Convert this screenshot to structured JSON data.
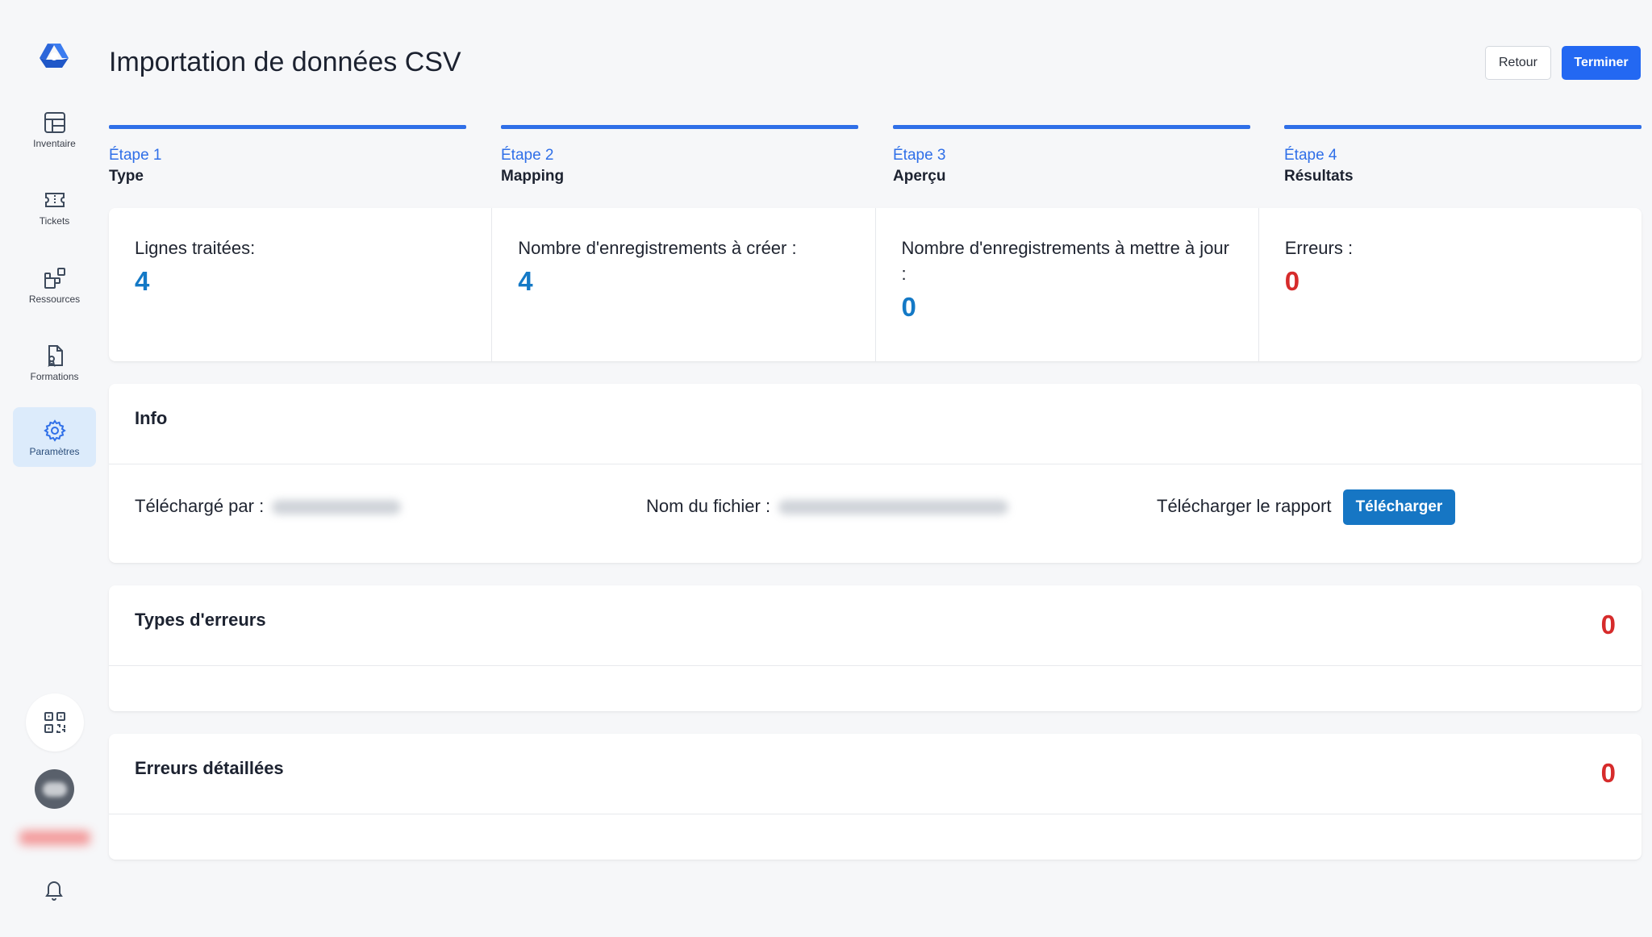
{
  "colors": {
    "accent": "#2f6fe8",
    "primary_button": "#2368f2",
    "download_button": "#1676c4",
    "count_blue": "#1479c6",
    "count_red": "#d62b2b",
    "sidebar_active_bg": "#dcebfb"
  },
  "sidebar": {
    "items": [
      {
        "label": "Inventaire",
        "icon": "table-icon"
      },
      {
        "label": "Tickets",
        "icon": "ticket-icon"
      },
      {
        "label": "Ressources",
        "icon": "resources-icon"
      },
      {
        "label": "Formations",
        "icon": "training-icon"
      },
      {
        "label": "Paramètres",
        "icon": "gear-icon"
      }
    ],
    "active": "Paramètres"
  },
  "header": {
    "title": "Importation de données CSV",
    "back_label": "Retour",
    "finish_label": "Terminer"
  },
  "steps": [
    {
      "number": "Étape 1",
      "name": "Type"
    },
    {
      "number": "Étape 2",
      "name": "Mapping"
    },
    {
      "number": "Étape 3",
      "name": "Aperçu"
    },
    {
      "number": "Étape 4",
      "name": "Résultats"
    }
  ],
  "stats": [
    {
      "label": "Lignes traitées:",
      "value": "4"
    },
    {
      "label": "Nombre d'enregistrements à créer :",
      "value": "4"
    },
    {
      "label": "Nombre d'enregistrements à mettre à jour :",
      "value": "0"
    },
    {
      "label": "Erreurs :",
      "value": "0"
    }
  ],
  "info": {
    "title": "Info",
    "uploaded_by_label": "Téléchargé par :",
    "file_name_label": "Nom du fichier :",
    "report_label": "Télécharger le rapport",
    "download_label": "Télécharger"
  },
  "error_types": {
    "title": "Types d'erreurs",
    "count": "0"
  },
  "error_details": {
    "title": "Erreurs détaillées",
    "count": "0"
  }
}
